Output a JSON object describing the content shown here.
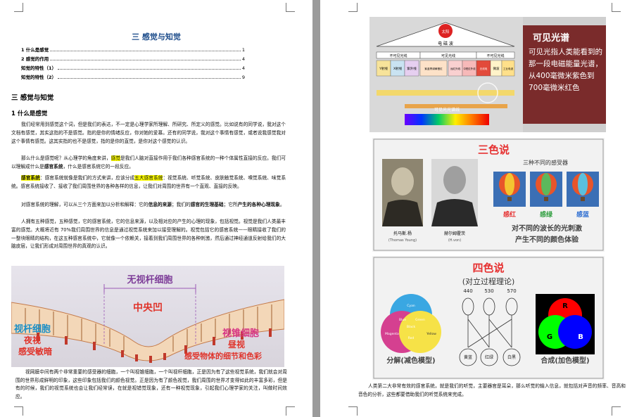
{
  "left_page": {
    "toc": {
      "title": "三  感觉与知觉",
      "entries": [
        {
          "label": "1  什么是感觉",
          "page": "1"
        },
        {
          "label": "2  感觉的作用",
          "page": "4"
        },
        {
          "label": "知觉的特性（1）",
          "page": "4"
        },
        {
          "label": "知觉的特性（2）",
          "page": "9"
        }
      ]
    },
    "heading1": "三  感觉与知觉",
    "heading2": "1  什么是感觉",
    "p1": "我们经常用到感觉这个词，但是我们的表达，不一定是心理学家所理解、所研究、所定义的感觉。比如说有的同学说，我对这个文档有感觉，其实这指的不是感觉。指的是你的情绪反应，你对她的爱慕。还有的同学说，我对这个事情有感觉，或者说我感觉我对这个事情有感觉。这其实指的也不是感觉，指的是你的直觉，是你对这个感觉的认识。",
    "p2_a": "那么什么是感觉呢？从心理学的角度来讲，",
    "p2_hl": "感觉",
    "p2_b": "是我们人脑对直接作用于我们各种感官系统的一种个体属性直接的反应。我们可以理解成什么是",
    "p2_bold": "感官系统",
    "p2_c": "，什么是感官系统它的一段反应。",
    "p3_hl1": "感官系统",
    "p3_a": "：感官系统就像是我们的方式来讲，应该分成",
    "p3_hl2": "五大感官系统",
    "p3_b": "：视觉系统、听觉系统、皮肤触觉系统、嗅觉系统、味觉系统。感官系统接收了、接收了我们周围世界的各种各样的信息，让我们对周围的世界有一个直观、直接的反映。",
    "p4_a": "对感官系统的理解，可以从三个方面来加以分析和解释：它的",
    "p4_bold1": "信息的来源",
    "p4_b": "；我们的",
    "p4_bold2": "感官的生理基础",
    "p4_c": "；它所",
    "p4_bold3": "产生的各种心理现象",
    "p4_d": "。",
    "p5": "人拥有五种感觉，五种感觉，它的感官系统，它的信息来源，以及相对应的产生的心理的现象，包括视觉。视觉是我们人类最丰富的感觉。大概将近有 70%我们周围世界的信息是通过视觉系统来加以接受理解的。视觉包括它的感官系统——眼睛接收了我们的一整块眼睛的结构，在这五种感官系统中，它就像一个依赖关，接着到我们周围世界的各种刺激，然后通过神经通道反射给我们的大脑皮层，让我们形成对周围世界的真观的认识。",
    "bottom_text": "视网膜中间有两个非常重要的感受器的细胞，一个叫视锥细胞，一个叫视杆细胞，正是因为有了这些视觉系统，我们就会对周围的世界形成鲜明的印象，这些印象包括我们的颜色视觉。正是因为有了颜色视觉，我们周围的世界才变得如此的丰富多彩，但是有的时候，我们的视觉系统也会让我们经常误，在就是视错觉现象，还有一种视觉现象，引起我们心理学家的关注，叫做时间效应。",
    "retina_figure": {
      "label_rod_free": "无视杆细胞",
      "label_fovea": "中央凹",
      "label_rod": "视杆细胞",
      "label_night": "夜视",
      "label_dark": "感受敏暗",
      "label_cone": "视锥细胞",
      "label_day": "昼视",
      "label_detail": "感受物体的细节和色彩"
    }
  },
  "right_page": {
    "spectrum_figure": {
      "sun": "太阳",
      "em_wave": "电  磁  波",
      "invisible1": "不可见光线",
      "visible": "可见光线",
      "invisible2": "不可见光线",
      "bands": [
        "Y射线",
        "X射线",
        "紫外线",
        "紫蓝青绿黄橙红",
        "远红外线",
        "中短红外线",
        "无线电",
        "微波",
        "工业电波"
      ],
      "title": "可见光谱",
      "desc": "可见光指人类能看到的那一段电磁能量光谱，从400毫微米紫色到700毫微米红色",
      "bar_label": "可见光光谱线"
    },
    "trichromatic_figure": {
      "title": "三色说",
      "subtitle": "三种不同的感受器",
      "person1": "托马斯.杨",
      "person1_en": "(Thomas Young)",
      "person2": "赫尔姆霍茨",
      "person2_en": "(H.von)",
      "balloons": [
        "感红",
        "感绿",
        "感蓝"
      ],
      "caption_line1": "对不同的波长的光刺激",
      "caption_line2": "产生不同的颜色体验"
    },
    "opponent_figure": {
      "title": "四色说",
      "subtitle": "(对立过程理论)",
      "wavelengths": [
        "440",
        "530",
        "570"
      ],
      "circle_labels": [
        "Cyan",
        "Blue",
        "Green",
        "Black",
        "Magenta",
        "Red",
        "Yellow"
      ],
      "pairs": [
        "黄蓝",
        "红绿",
        "白黑"
      ],
      "rgb_labels": [
        "R",
        "G",
        "B"
      ],
      "left_caption": "分解(减色模型)",
      "right_caption": "合成(加色模型)"
    },
    "bottom_text": "人类第二大非常有效的感官系统，就是我们的听觉，主要器官是耳朵，那么听觉的输入信息，就包括对声音的频率、音高和音色的分析，这些都要借助我们的听觉系统来完成。"
  },
  "colors": {
    "toc_title": "#1f4e8c",
    "highlight": "#ffff00",
    "gray_background": "#9b9b9b"
  }
}
